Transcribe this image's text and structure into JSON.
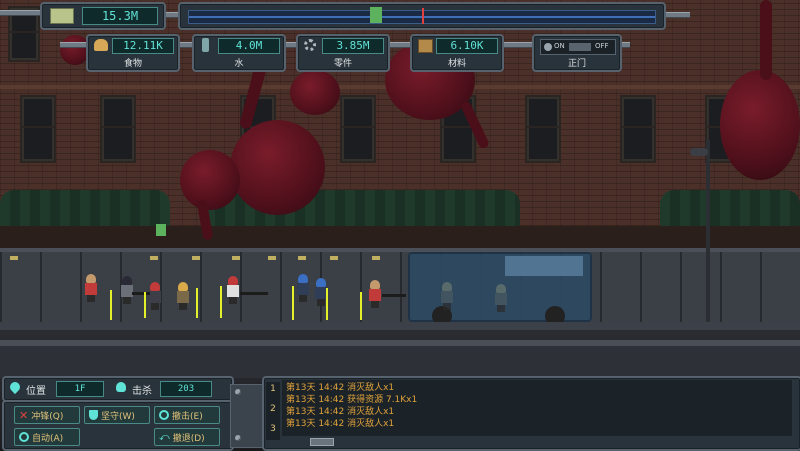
{
  "hud": {
    "money": "15.3M",
    "progress_marker_color": "#e04040"
  },
  "resources": [
    {
      "icon": "bread-icon",
      "value": "12.11K",
      "label": "食物"
    },
    {
      "icon": "water-bottle-icon",
      "value": "4.0M",
      "label": "水"
    },
    {
      "icon": "gear-icon",
      "value": "3.85M",
      "label": "零件"
    },
    {
      "icon": "crate-icon",
      "value": "6.10K",
      "label": "材料"
    }
  ],
  "gate": {
    "label": "正门",
    "on": "ON",
    "off": "OFF"
  },
  "status": {
    "position_label": "位置",
    "position_value": "1F",
    "kills_label": "击杀",
    "kills_value": "203"
  },
  "commands": [
    {
      "icon": "cross-icon",
      "label": "冲锋(Q)"
    },
    {
      "icon": "shield-icon",
      "label": "坚守(W)"
    },
    {
      "icon": "radar-icon",
      "label": "撤击(E)"
    },
    {
      "icon": "target-icon",
      "label": "自动(A)"
    },
    {
      "icon": "retreat-icon",
      "label": "撤退(D)"
    }
  ],
  "log": {
    "tabs": [
      "1",
      "2",
      "3"
    ],
    "lines": [
      "第13天 14:42 消灭敌人x1",
      "第13天 14:42 获得资源 7.1Kx1",
      "第13天 14:42 消灭敌人x1",
      "第13天 14:42 消灭敌人x1"
    ]
  }
}
